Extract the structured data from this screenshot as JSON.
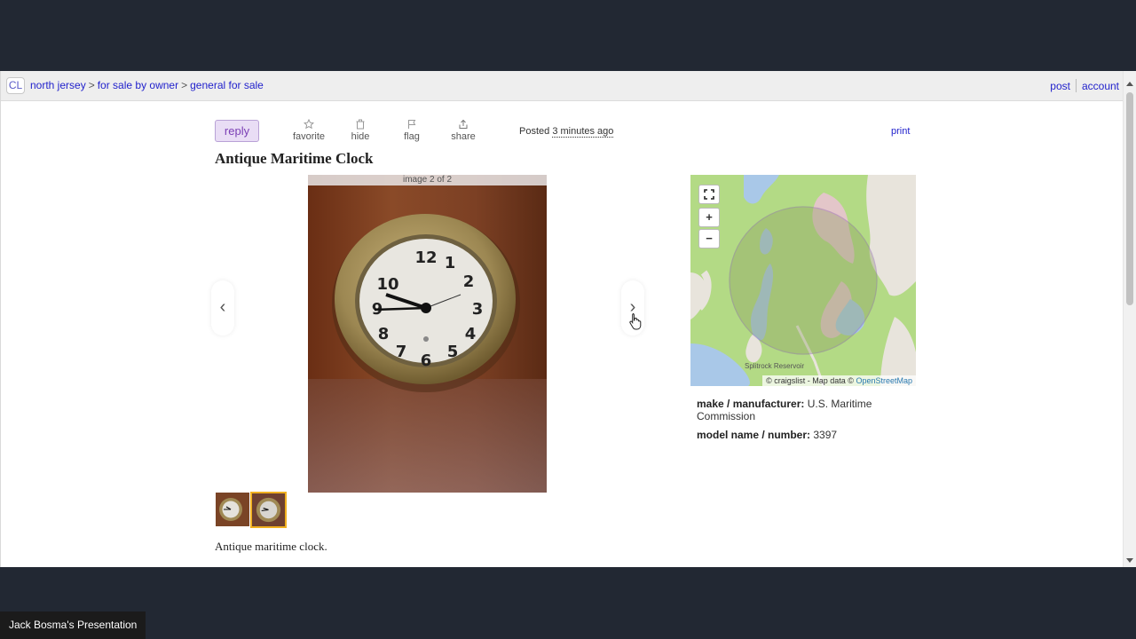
{
  "header": {
    "logo": "CL",
    "breadcrumbs": [
      "north jersey",
      "for sale by owner",
      "general for sale"
    ],
    "breadcrumb_separator": ">",
    "right_links": [
      "post",
      "account"
    ]
  },
  "actions": {
    "reply": "reply",
    "favorite": "favorite",
    "hide": "hide",
    "flag": "flag",
    "share": "share",
    "posted_prefix": "Posted",
    "posted_time": "3 minutes ago",
    "print": "print"
  },
  "listing": {
    "title": "Antique Maritime Clock",
    "image_caption": "image 2 of 2",
    "prev_arrow": "‹",
    "next_arrow": "›",
    "description": "Antique maritime clock.",
    "attributes": [
      {
        "label": "make / manufacturer:",
        "value": "U.S. Maritime Commission"
      },
      {
        "label": "model name / number:",
        "value": "3397"
      }
    ]
  },
  "map": {
    "zoom_in": "+",
    "zoom_out": "−",
    "lake_label": "Splitrock Reservoir",
    "attribution_prefix": "© craigslist - Map data ©",
    "attribution_link": "OpenStreetMap"
  },
  "presenter": {
    "label": "Jack Bosma's Presentation"
  },
  "colors": {
    "link": "#2222cc",
    "page_bg": "#222833",
    "reply_bg": "#e9ddf5"
  }
}
